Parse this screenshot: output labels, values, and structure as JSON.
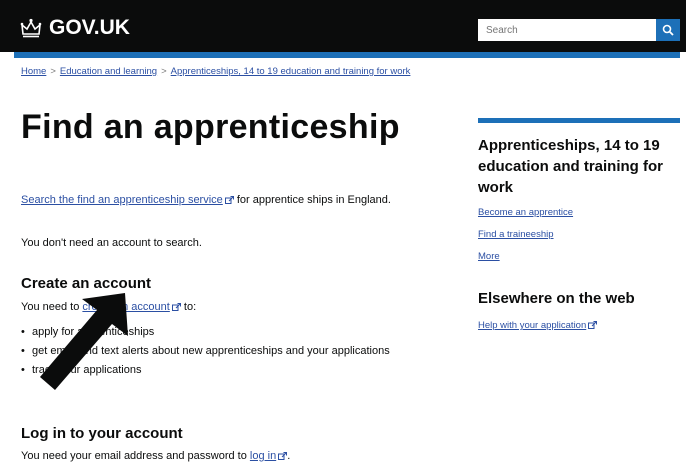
{
  "header": {
    "logo_text": "GOV.UK",
    "logo_icon": "crown-icon",
    "search_placeholder": "Search",
    "search_button_icon": "search-icon",
    "brand_color": "#1d70b8"
  },
  "breadcrumb": [
    "Home",
    "Education and learning",
    "Apprenticeships, 14 to 19 education and training for work"
  ],
  "main": {
    "title": "Find an apprenticeship",
    "intro_link": "Search the find an apprenticeship service",
    "intro_rest": " for apprentice ships in England.",
    "no_account_text": "You don't need an account to search.",
    "create_heading": "Create an account",
    "create_text_before": "You need to ",
    "create_link": "create an account",
    "create_text_after": " to:",
    "bullets": [
      "apply for apprenticeships",
      "get email and text alerts about new apprenticeships and your applications",
      "track your applications"
    ],
    "login_heading": "Log in to your account",
    "login_text_before": "You need your email address and password to ",
    "login_link": "log in",
    "login_text_after": "."
  },
  "sidebar": {
    "title": "Apprenticeships, 14 to 19 education and training for work",
    "links": [
      "Become an apprentice",
      "Find a traineeship",
      "More"
    ],
    "elsewhere_heading": "Elsewhere on the web",
    "elsewhere_link": "Help with your application"
  }
}
